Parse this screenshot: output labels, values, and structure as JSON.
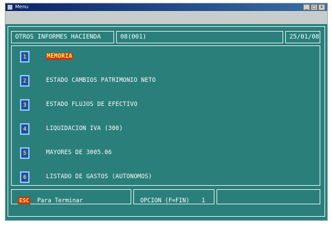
{
  "window": {
    "title": "Menu",
    "min_label": "_",
    "max_label": "□",
    "close_label": "×"
  },
  "header": {
    "section": "OTROS INFORMES HACIENDA",
    "code": "08(001)",
    "date": "25/01/08"
  },
  "menu": [
    {
      "key": "1",
      "label": "MEMORIA",
      "selected": true
    },
    {
      "key": "2",
      "label": "ESTADO CAMBIOS PATRIMONIO NETO",
      "selected": false
    },
    {
      "key": "3",
      "label": "ESTADO FLUJOS DE EFECTIVO",
      "selected": false
    },
    {
      "key": "4",
      "label": "LIQUIDACION IVA (300)",
      "selected": false
    },
    {
      "key": "5",
      "label": "MAYORES DE 3005.06",
      "selected": false
    },
    {
      "key": "6",
      "label": "LISTADO DE GASTOS (AUTONOMOS)",
      "selected": false
    }
  ],
  "footer": {
    "esc_key": "ESC",
    "esc_text": "Para Terminar",
    "option_label": "OPCION (F=FIN)",
    "option_value": "1"
  },
  "colors": {
    "background": "#2a7f7b",
    "key_blue": "#1d4fa4",
    "highlight_red": "#c7361e",
    "highlight_yellow": "#ffef4a"
  }
}
